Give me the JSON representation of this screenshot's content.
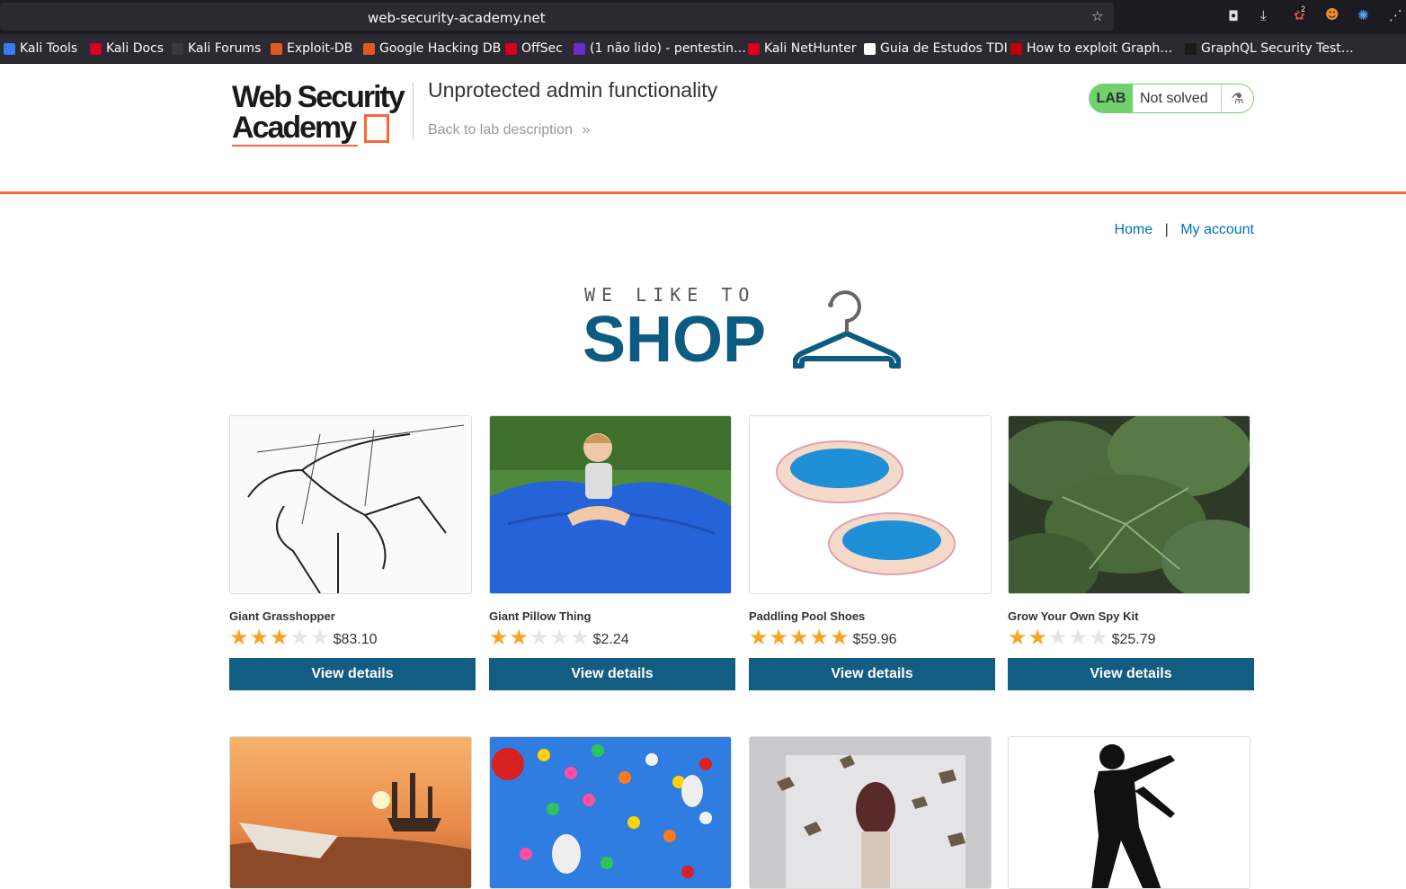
{
  "browser": {
    "url": "web-security-academy.net",
    "notification_count": "2",
    "bookmarks": [
      {
        "label": "Kali Tools",
        "color": "#367bf0"
      },
      {
        "label": "Kali Docs",
        "color": "#d9001b"
      },
      {
        "label": "Kali Forums",
        "color": "#2a2a2a"
      },
      {
        "label": "Exploit-DB",
        "color": "#e05a1f"
      },
      {
        "label": "Google Hacking DB",
        "color": "#e05a1f"
      },
      {
        "label": "OffSec",
        "color": "#d9001b"
      },
      {
        "label": "(1 não lido) - pentestin…",
        "color": "#6a2ccf"
      },
      {
        "label": "Kali NetHunter",
        "color": "#d9001b"
      },
      {
        "label": "Guia de Estudos TDI",
        "color": "#ffffff"
      },
      {
        "label": "How to exploit Graph…",
        "color": "#c00000"
      },
      {
        "label": "GraphQL Security Test…",
        "color": "#1a1a1a"
      }
    ]
  },
  "lab": {
    "logo_line1": "Web Security",
    "logo_line2": "Academy",
    "title": "Unprotected admin functionality",
    "back_link": "Back to lab description",
    "back_chevron": "»",
    "badge_label": "LAB",
    "status": "Not solved",
    "accent_color": "#ff6633"
  },
  "nav": {
    "home": "Home",
    "separator": "|",
    "my_account": "My account"
  },
  "banner": {
    "small_text": "WE LIKE TO",
    "big_text": "SHOP"
  },
  "products": [
    {
      "name": "Giant Grasshopper",
      "rating": 3,
      "price": "$83.10",
      "button": "View details"
    },
    {
      "name": "Giant Pillow Thing",
      "rating": 2,
      "price": "$2.24",
      "button": "View details"
    },
    {
      "name": "Paddling Pool Shoes",
      "rating": 5,
      "price": "$59.96",
      "button": "View details"
    },
    {
      "name": "Grow Your Own Spy Kit",
      "rating": 2,
      "price": "$25.79",
      "button": "View details"
    }
  ],
  "products_row2_count": 4
}
